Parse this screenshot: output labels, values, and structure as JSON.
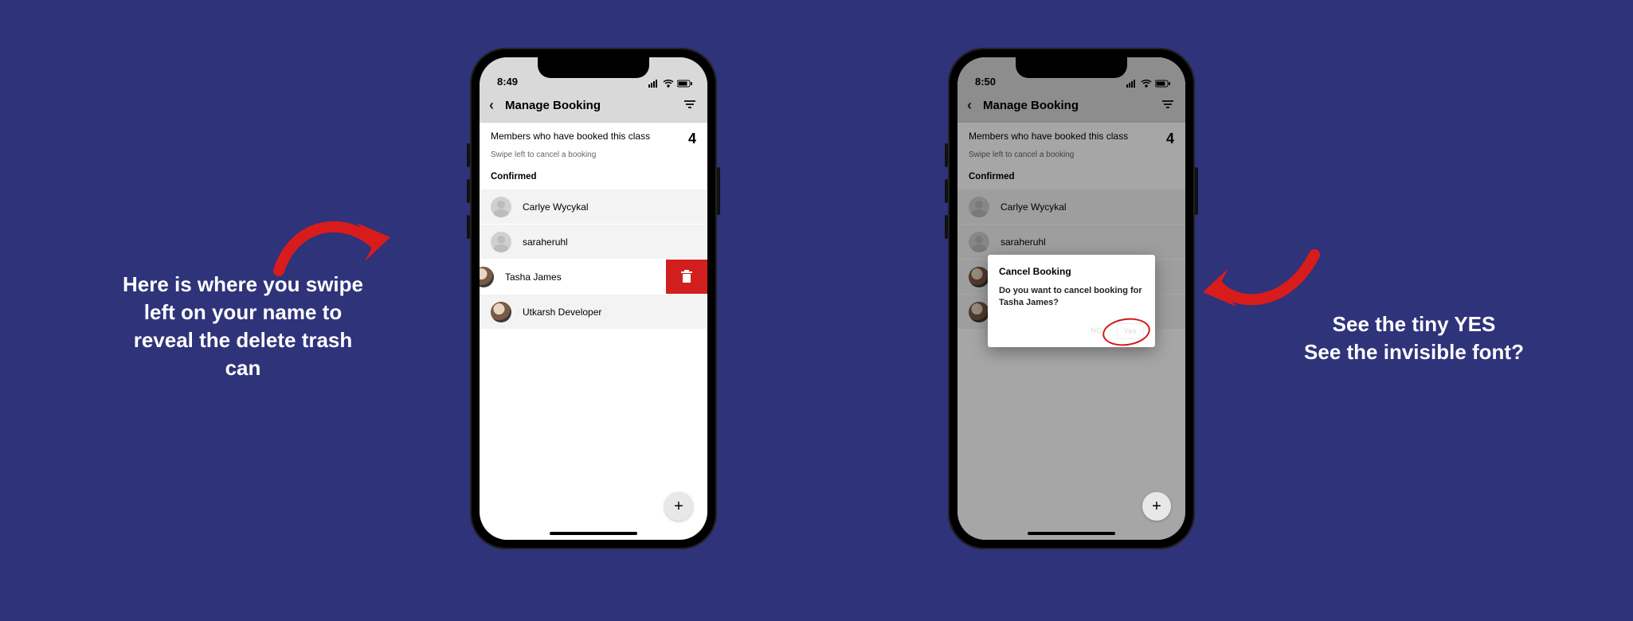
{
  "callouts": {
    "left": "Here is where you swipe left on your name to reveal the delete trash can",
    "right_line1": "See the tiny YES",
    "right_line2": "See the invisible font?"
  },
  "phone1": {
    "status_time": "8:49",
    "header_title": "Manage Booking",
    "info_label": "Members who have booked this class",
    "count": "4",
    "hint": "Swipe left to cancel a booking",
    "section": "Confirmed",
    "members": [
      {
        "name": "Carlye Wycykal"
      },
      {
        "name": "saraheruhl"
      },
      {
        "name": "Tasha James"
      },
      {
        "name": "Utkarsh Developer"
      }
    ],
    "fab": "+"
  },
  "phone2": {
    "status_time": "8:50",
    "header_title": "Manage Booking",
    "info_label": "Members who have booked this class",
    "count": "4",
    "hint": "Swipe left to cancel a booking",
    "section": "Confirmed",
    "members": [
      {
        "name": "Carlye Wycykal"
      },
      {
        "name": "saraheruhl"
      }
    ],
    "dialog": {
      "title": "Cancel Booking",
      "message": "Do you want to cancel booking for Tasha James?",
      "no": "NO",
      "yes": "Yes"
    },
    "fab": "+"
  }
}
